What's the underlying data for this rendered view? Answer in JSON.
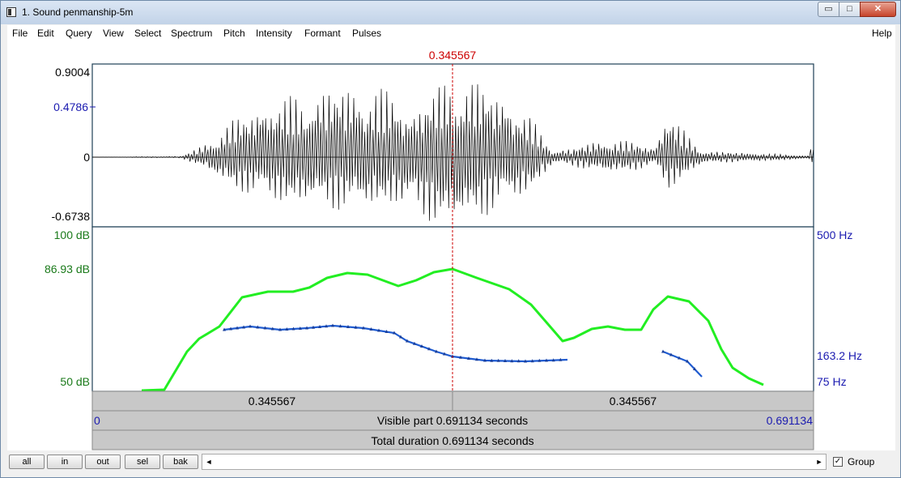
{
  "window": {
    "title": "1. Sound penmanship-5m"
  },
  "window_buttons": {
    "minimize": "▭",
    "maximize": "□",
    "close": "✕"
  },
  "menu": {
    "items": [
      "File",
      "Edit",
      "Query",
      "View",
      "Select",
      "Spectrum",
      "Pitch",
      "Intensity",
      "Formant",
      "Pulses"
    ],
    "help": "Help"
  },
  "cursor": {
    "time_label": "0.345567"
  },
  "waveform": {
    "max_label": "0.9004",
    "cursor_value": "0.4786",
    "zero_label": "0",
    "min_label": "-0.6738"
  },
  "intensity": {
    "top_label": "100 dB",
    "cursor_label": "86.93 dB",
    "bottom_label": "50 dB"
  },
  "pitch": {
    "top_label": "500 Hz",
    "cursor_label": "163.2 Hz",
    "bottom_label": "75 Hz"
  },
  "time_bars": {
    "left_segment": "0.345567",
    "right_segment": "0.345567",
    "visible_start": "0",
    "visible_label": "Visible part 0.691134 seconds",
    "visible_end": "0.691134",
    "total_label": "Total duration 0.691134 seconds"
  },
  "footer": {
    "buttons": [
      "all",
      "in",
      "out",
      "sel",
      "bak"
    ],
    "scroll_left": "◄",
    "scroll_right": "►",
    "group_checked": "✓",
    "group_label": "Group"
  },
  "colors": {
    "cursor": "#cc0000",
    "intensity": "#22ee22",
    "pitch": "#1f5bd0",
    "label_blue": "#1a1ab0",
    "label_green": "#1a7a1a"
  }
}
